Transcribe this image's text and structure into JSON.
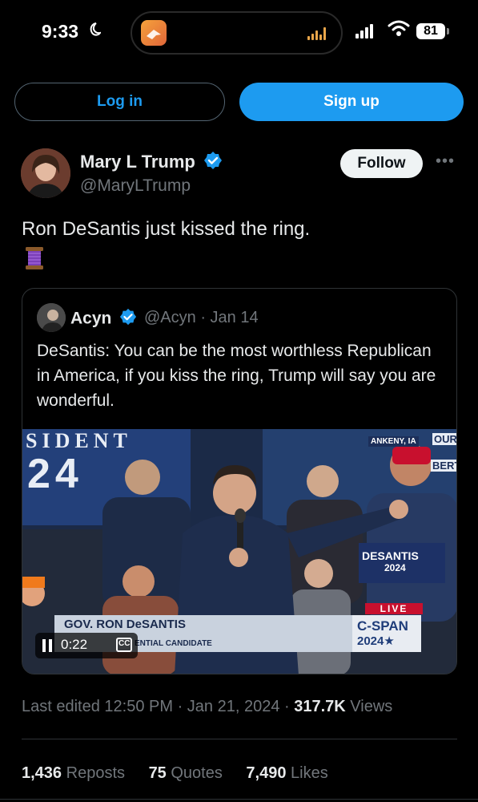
{
  "status_bar": {
    "time": "9:33",
    "battery": "81"
  },
  "auth": {
    "login_label": "Log in",
    "signup_label": "Sign up"
  },
  "tweet": {
    "author_name": "Mary L Trump",
    "author_handle": "@MaryLTrump",
    "follow_label": "Follow",
    "more_label": "•••",
    "text": "Ron DeSantis just kissed the ring.",
    "emoji_icon": "thread-spool-icon"
  },
  "quote": {
    "author_name": "Acyn",
    "handle_date": "@Acyn · Jan 14",
    "text": "DeSantis: You can be the most worthless Republican in America, if you kiss the ring, Trump will say you are wonderful.",
    "video": {
      "banner_left": "SIDENT",
      "banner_num": "24",
      "location": "ANKENY, IA",
      "sign_1": "DESANTIS",
      "sign_2": "2024",
      "lower_third_name": "GOV. RON DeSANTIS",
      "lower_third_title": "ENTIAL CANDIDATE",
      "live_label": "LIVE",
      "network": "C-SPAN",
      "network_year": "2024★",
      "timestamp": "0:22",
      "cc_label": "CC",
      "right_banner": "OUR",
      "right_banner2": "BERT"
    }
  },
  "meta": {
    "edited": "Last edited 12:50 PM · Jan 21, 2024 · ",
    "views_count": "317.7K",
    "views_label": " Views"
  },
  "stats": {
    "reposts_count": "1,436",
    "reposts_label": "Reposts",
    "quotes_count": "75",
    "quotes_label": "Quotes",
    "likes_count": "7,490",
    "likes_label": "Likes"
  },
  "colors": {
    "accent": "#1d9bf0",
    "background": "#000000",
    "muted": "#71767b",
    "text": "#e7e9ea"
  }
}
